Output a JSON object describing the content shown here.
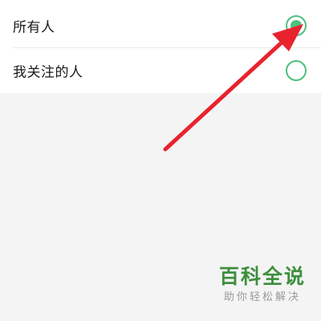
{
  "options": [
    {
      "label": "所有人",
      "selected": true
    },
    {
      "label": "我关注的人",
      "selected": false
    }
  ],
  "colors": {
    "accent": "#4fbf7e",
    "arrow": "#e8232e",
    "watermark_green": "#3d8f3d",
    "background": "#f4f4f4"
  },
  "watermark": {
    "title": "百科全说",
    "subtitle": "助你轻松解决"
  }
}
